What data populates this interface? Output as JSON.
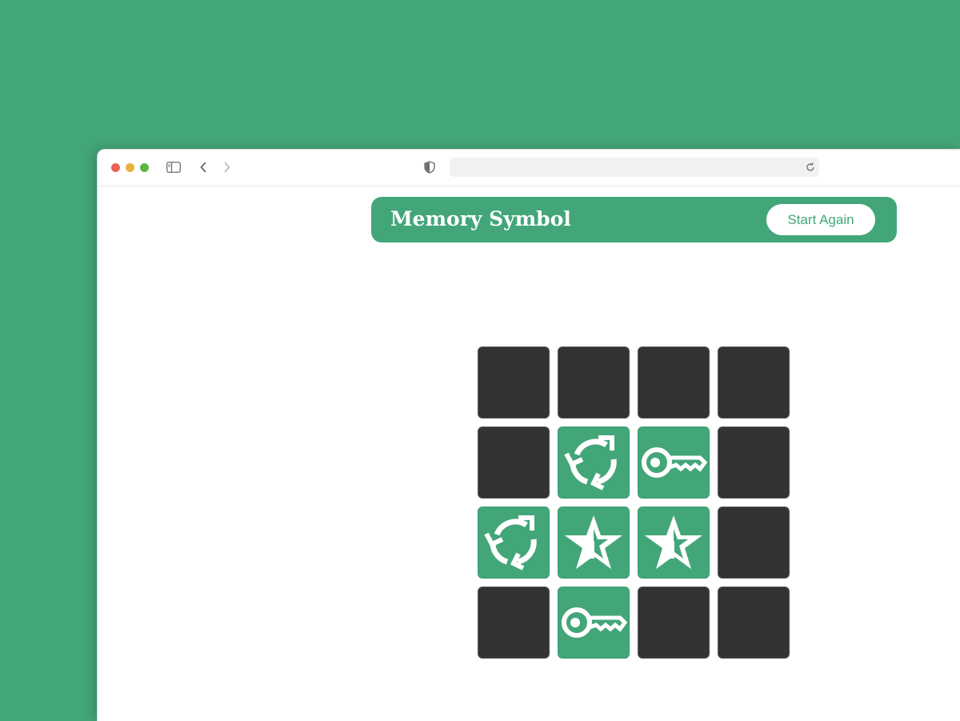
{
  "browser": {
    "traffic_lights": [
      {
        "name": "close",
        "color": "#ec5f57"
      },
      {
        "name": "minimize",
        "color": "#e9b33b"
      },
      {
        "name": "maximize",
        "color": "#57b844"
      }
    ],
    "icons": [
      "sidebar-toggle-icon",
      "back-icon",
      "forward-icon",
      "shield-icon",
      "reload-icon"
    ],
    "address": ""
  },
  "header": {
    "title": "Memory Symbol",
    "restart_label": "Start Again"
  },
  "colors": {
    "accent": "#43a679",
    "card_back": "#333333",
    "text_on_accent": "#ffffff"
  },
  "board": {
    "columns": 4,
    "rows": 4,
    "cards": [
      {
        "state": "hidden"
      },
      {
        "state": "hidden"
      },
      {
        "state": "hidden"
      },
      {
        "state": "hidden"
      },
      {
        "state": "hidden"
      },
      {
        "state": "revealed",
        "symbol": "recycle-arrows-icon"
      },
      {
        "state": "revealed",
        "symbol": "key-icon"
      },
      {
        "state": "hidden"
      },
      {
        "state": "revealed",
        "symbol": "recycle-arrows-icon"
      },
      {
        "state": "revealed",
        "symbol": "half-star-icon"
      },
      {
        "state": "revealed",
        "symbol": "half-star-icon"
      },
      {
        "state": "hidden"
      },
      {
        "state": "hidden"
      },
      {
        "state": "revealed",
        "symbol": "key-icon"
      },
      {
        "state": "hidden"
      },
      {
        "state": "hidden"
      }
    ]
  }
}
